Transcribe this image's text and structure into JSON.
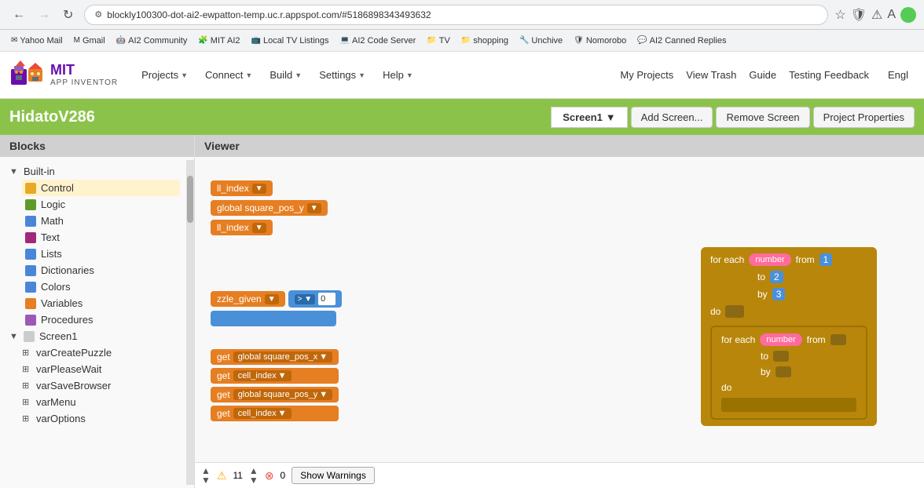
{
  "browser": {
    "address": "blockly100300-dot-ai2-ewpatton-temp.uc.r.appspot.com/#5186898343493632",
    "back_disabled": false,
    "forward_disabled": false
  },
  "bookmarks": [
    {
      "label": "Yahoo Mail",
      "icon": "✉"
    },
    {
      "label": "Gmail",
      "icon": "M"
    },
    {
      "label": "AI2 Community",
      "icon": "🤖"
    },
    {
      "label": "MIT AI2",
      "icon": "🧩"
    },
    {
      "label": "Local TV Listings",
      "icon": "📺"
    },
    {
      "label": "AI2 Code Server",
      "icon": "💻"
    },
    {
      "label": "TV",
      "icon": "📁"
    },
    {
      "label": "shopping",
      "icon": "📁"
    },
    {
      "label": "Unchive",
      "icon": "🔧"
    },
    {
      "label": "Nomorobo",
      "icon": "🛡"
    },
    {
      "label": "AI2 Canned Replies",
      "icon": "💬"
    }
  ],
  "logo": {
    "mit": "MIT",
    "app_inventor": "APP INVENTOR"
  },
  "nav": {
    "items": [
      {
        "label": "Projects",
        "has_dropdown": true
      },
      {
        "label": "Connect",
        "has_dropdown": true
      },
      {
        "label": "Build",
        "has_dropdown": true
      },
      {
        "label": "Settings",
        "has_dropdown": true
      },
      {
        "label": "Help",
        "has_dropdown": true
      }
    ]
  },
  "header_right": {
    "my_projects": "My Projects",
    "view_trash": "View Trash",
    "guide": "Guide",
    "testing_feedback": "Testing Feedback",
    "language": "Engl"
  },
  "toolbar": {
    "project_name": "HidatoV286",
    "screen_label": "Screen1",
    "add_screen": "Add Screen...",
    "remove_screen": "Remove Screen",
    "project_properties": "Project Properties"
  },
  "blocks_panel": {
    "header": "Blocks",
    "builtin_label": "Built-in",
    "items": [
      {
        "label": "Control",
        "color": "#E9A825",
        "active": true
      },
      {
        "label": "Logic",
        "color": "#5C9B2A"
      },
      {
        "label": "Math",
        "color": "#4A86D8"
      },
      {
        "label": "Text",
        "color": "#A1287A"
      },
      {
        "label": "Lists",
        "color": "#4A86D8"
      },
      {
        "label": "Dictionaries",
        "color": "#4A86D8"
      },
      {
        "label": "Colors",
        "color": "#4A86D8"
      },
      {
        "label": "Variables",
        "color": "#E67E22"
      },
      {
        "label": "Procedures",
        "color": "#9B59B6"
      }
    ],
    "screen1_label": "Screen1",
    "screen1_items": [
      {
        "label": "varCreatePuzzle"
      },
      {
        "label": "varPleaseWait"
      },
      {
        "label": "varSaveBrowser"
      },
      {
        "label": "varMenu"
      },
      {
        "label": "varOptions"
      }
    ]
  },
  "viewer": {
    "header": "Viewer"
  },
  "blocks_in_viewer": {
    "ll_index_1": "ll_index",
    "global_square_pos_y": "global square_pos_y",
    "ll_index_2": "ll_index",
    "puzzle_given": "zzle_given",
    "gt_op": ">",
    "zero": "0",
    "get_blocks": [
      {
        "prefix": "get",
        "var": "global square_pos_x"
      },
      {
        "prefix": "get",
        "var": "cell_index"
      },
      {
        "prefix": "get",
        "var": "global square_pos_y"
      },
      {
        "prefix": "get",
        "var": "cell_index"
      }
    ],
    "for_each_1": {
      "each_label": "for each",
      "number_label": "number",
      "from_label": "from",
      "from_val": "1",
      "to_label": "to",
      "to_val": "2",
      "by_label": "by",
      "by_val": "3",
      "do_label": "do"
    },
    "for_each_2": {
      "each_label": "for each",
      "number_label": "number",
      "from_label": "from",
      "to_label": "to",
      "by_label": "by",
      "do_label": "do"
    }
  },
  "warnings": {
    "count": "11",
    "errors": "0",
    "show_label": "Show Warnings"
  }
}
